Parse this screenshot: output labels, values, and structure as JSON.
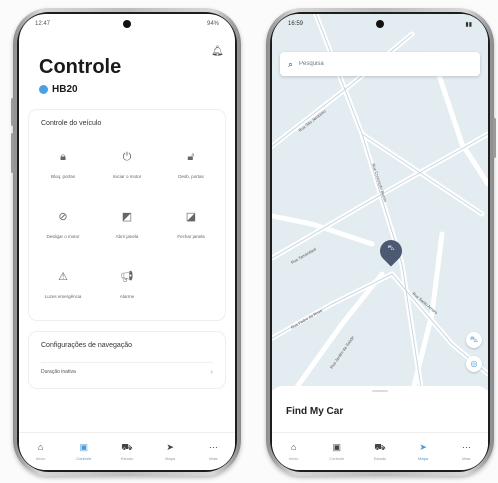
{
  "left_phone": {
    "status": {
      "time": "12:47",
      "battery": "94%"
    },
    "header": {
      "title": "Controle",
      "car": "HB20",
      "notifications_icon": "bell-icon"
    },
    "vehicle_controls": {
      "title": "Controle do veículo",
      "items": [
        {
          "label": "Bloq. portas",
          "icon": "lock-icon"
        },
        {
          "label": "Iniciar o motor",
          "icon": "power-icon"
        },
        {
          "label": "Desb. portas",
          "icon": "unlock-icon"
        },
        {
          "label": "Desligar o motor",
          "icon": "power-off-icon"
        },
        {
          "label": "Abrir janela",
          "icon": "window-open-icon"
        },
        {
          "label": "Fechar janela",
          "icon": "window-close-icon"
        },
        {
          "label": "Luzes emergência",
          "icon": "hazard-icon"
        },
        {
          "label": "Alarme",
          "icon": "horn-icon"
        }
      ]
    },
    "navigation_settings": {
      "title": "Configurações de navegação",
      "row_label": "Duração inativa"
    },
    "bottom_nav": [
      {
        "label": "Início",
        "icon": "home-icon"
      },
      {
        "label": "Controle",
        "icon": "remote-icon"
      },
      {
        "label": "Estado",
        "icon": "car-icon"
      },
      {
        "label": "Mapa",
        "icon": "navigation-icon"
      },
      {
        "label": "Mais",
        "icon": "more-icon"
      }
    ],
    "active_tab": "Controle"
  },
  "right_phone": {
    "status": {
      "time": "16:59"
    },
    "search": {
      "placeholder": "Pesquisa"
    },
    "streets": [
      "Rua São Jeronimo",
      "Rua Conceição Bueno",
      "Rua Tamandaré",
      "Rua Pedro da Rosa",
      "Rua Santo Amaro",
      "Rua Jardim da Saúde"
    ],
    "sheet": {
      "title": "Find My Car"
    },
    "bottom_nav": [
      {
        "label": "Início",
        "icon": "home-icon"
      },
      {
        "label": "Controle",
        "icon": "remote-icon"
      },
      {
        "label": "Estado",
        "icon": "car-icon"
      },
      {
        "label": "Mapa",
        "icon": "navigation-icon"
      },
      {
        "label": "Mais",
        "icon": "more-icon"
      }
    ],
    "active_tab": "Mapa"
  },
  "colors": {
    "accent": "#4a9ad8",
    "pin": "#4b5a72",
    "map_bg": "#e3ecf1"
  }
}
